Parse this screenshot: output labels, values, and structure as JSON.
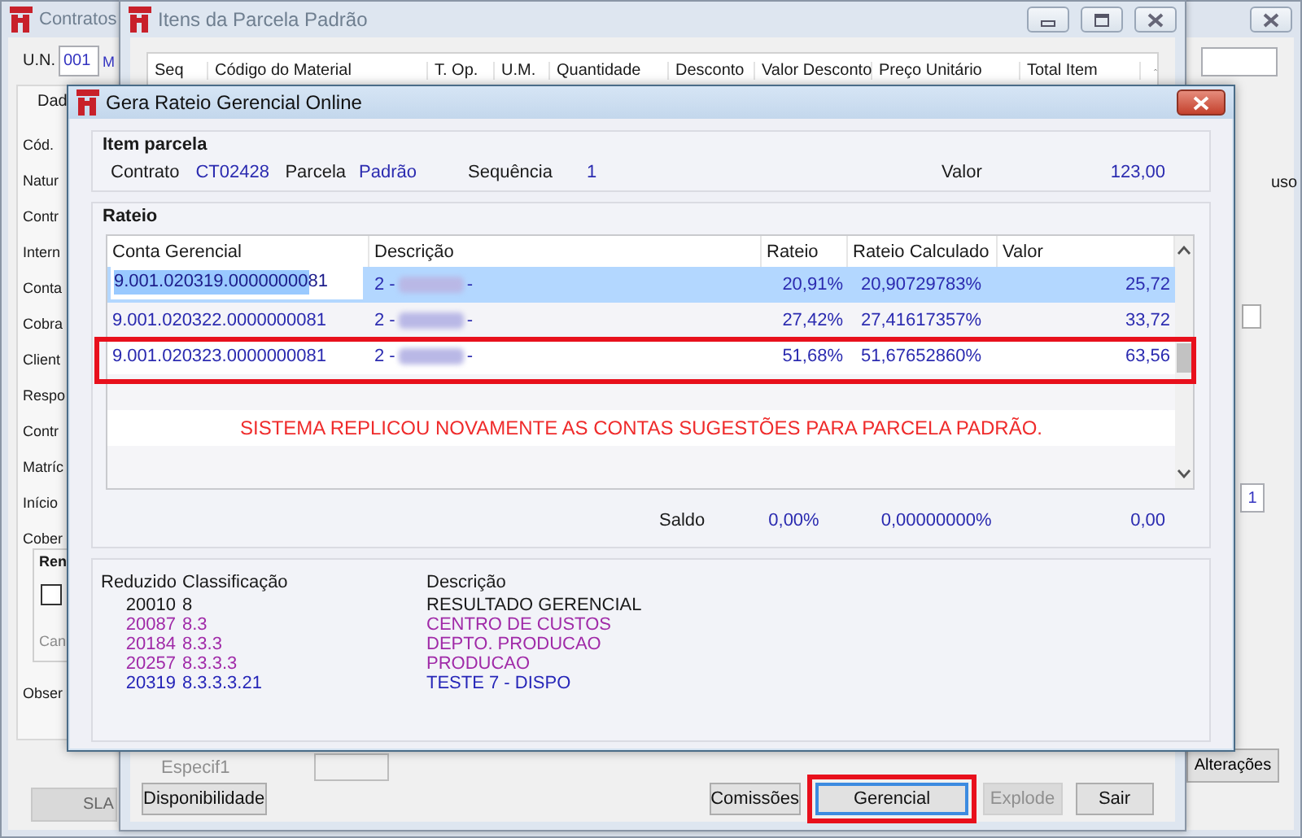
{
  "contratos": {
    "title": "Contratos",
    "un_label": "U.N.",
    "un_value": "001",
    "un_extra": "M",
    "tab": "Dad",
    "labels": [
      "Cód.",
      "Natur",
      "Contr",
      "Intern",
      "Conta",
      "Cobra",
      "Client",
      "Respo",
      "Contr",
      "Matríc",
      "Início",
      "Cober"
    ],
    "group_label": "Ren",
    "checkbox": {
      "checked": false
    },
    "cancel_label": "Can",
    "obs_label": "Obser",
    "sla_button": "SLA",
    "right_label": "uso",
    "right_checkbox": {
      "checked": false
    },
    "right_field": "1",
    "alteracoes_button": "Alterações"
  },
  "itens": {
    "title": "Itens da Parcela Padrão",
    "columns": [
      "Seq",
      "Código do Material",
      "T. Op.",
      "U.M.",
      "Quantidade",
      "Desconto",
      "Valor Desconto",
      "Preço Unitário",
      "Total Item"
    ],
    "especif_label": "Especif1",
    "buttons": [
      {
        "label": "Disponibilidade",
        "disabled": false,
        "focused": false,
        "highlighted": false
      },
      {
        "label": "Comissões",
        "disabled": false,
        "focused": false,
        "highlighted": false
      },
      {
        "label": "Gerencial",
        "disabled": false,
        "focused": true,
        "highlighted": true
      },
      {
        "label": "Explode",
        "disabled": true,
        "focused": false,
        "highlighted": false
      },
      {
        "label": "Sair",
        "disabled": false,
        "focused": false,
        "highlighted": false
      }
    ]
  },
  "rateio": {
    "title": "Gera Rateio Gerencial Online",
    "item_parcela": {
      "heading": "Item parcela",
      "contrato_label": "Contrato",
      "contrato": "CT02428",
      "parcela_label": "Parcela",
      "parcela": "Padrão",
      "sequencia_label": "Sequência",
      "sequencia": "1",
      "valor_label": "Valor",
      "valor": "123,00"
    },
    "heading": "Rateio",
    "columns": [
      "Conta Gerencial",
      "Descrição",
      "Rateio",
      "Rateio Calculado",
      "Valor"
    ],
    "rows": [
      {
        "conta": "9.001.020319.0000000081",
        "descricao": "2 -",
        "descricao_end": "-",
        "rateio": "20,91%",
        "calculado": "20,90729783%",
        "valor": "25,72",
        "selected": true,
        "highlighted": false
      },
      {
        "conta": "9.001.020322.0000000081",
        "descricao": "2 -",
        "descricao_end": "-",
        "rateio": "27,42%",
        "calculado": "27,41617357%",
        "valor": "33,72",
        "selected": false,
        "highlighted": false
      },
      {
        "conta": "9.001.020323.0000000081",
        "descricao": "2 -",
        "descricao_end": "-",
        "rateio": "51,68%",
        "calculado": "51,67652860%",
        "valor": "63,56",
        "selected": false,
        "highlighted": true
      }
    ],
    "note": "SISTEMA REPLICOU NOVAMENTE AS CONTAS SUGESTÕES PARA PARCELA PADRÃO.",
    "saldo": {
      "label": "Saldo",
      "rateio": "0,00%",
      "calculado": "0,00000000%",
      "valor": "0,00"
    },
    "accounts_columns": [
      "Reduzido",
      "Classificação",
      "Descrição"
    ],
    "accounts": [
      {
        "reduzido": "20010",
        "classificacao": "8",
        "descricao": "RESULTADO GERENCIAL",
        "color": "#1a1a1a"
      },
      {
        "reduzido": "20087",
        "classificacao": "8.3",
        "descricao": "CENTRO DE CUSTOS",
        "color": "#a02aa8"
      },
      {
        "reduzido": "20184",
        "classificacao": "8.3.3",
        "descricao": "DEPTO. PRODUCAO",
        "color": "#a02aa8"
      },
      {
        "reduzido": "20257",
        "classificacao": "8.3.3.3",
        "descricao": "PRODUCAO",
        "color": "#a02aa8"
      },
      {
        "reduzido": "20319",
        "classificacao": "8.3.3.3.21",
        "descricao": "TESTE 7 - DISPO",
        "color": "#2626b8"
      }
    ]
  }
}
